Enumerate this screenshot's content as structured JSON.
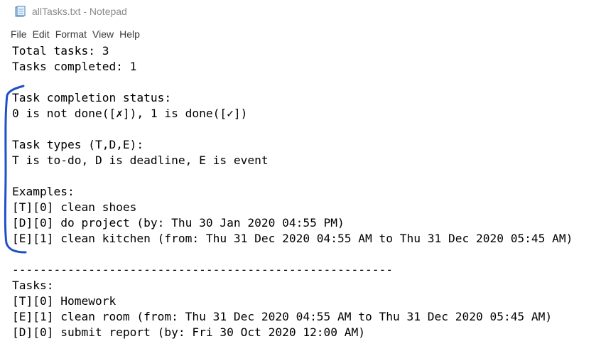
{
  "window": {
    "title": "allTasks.txt - Notepad",
    "icon": "notepad-icon"
  },
  "menu": [
    "File",
    "Edit",
    "Format",
    "View",
    "Help"
  ],
  "document": {
    "lines": [
      "Total tasks: 3",
      "Tasks completed: 1",
      "",
      "Task completion status:",
      "0 is not done([✗]), 1 is done([✓])",
      "",
      "Task types (T,D,E):",
      "T is to-do, D is deadline, E is event",
      "",
      "Examples:",
      "[T][0] clean shoes",
      "[D][0] do project (by: Thu 30 Jan 2020 04:55 PM)",
      "[E][1] clean kitchen (from: Thu 31 Dec 2020 04:55 AM to Thu 31 Dec 2020 05:45 AM)",
      "",
      "-------------------------------------------------------",
      "Tasks:",
      "[T][0] Homework",
      "[E][1] clean room (from: Thu 31 Dec 2020 04:55 AM to Thu 31 Dec 2020 05:45 AM)",
      "[D][0] submit report (by: Fri 30 Oct 2020 12:00 AM)"
    ]
  },
  "colors": {
    "annotation_stroke": "#1f4fc9",
    "title_text": "#8a8a8a"
  }
}
